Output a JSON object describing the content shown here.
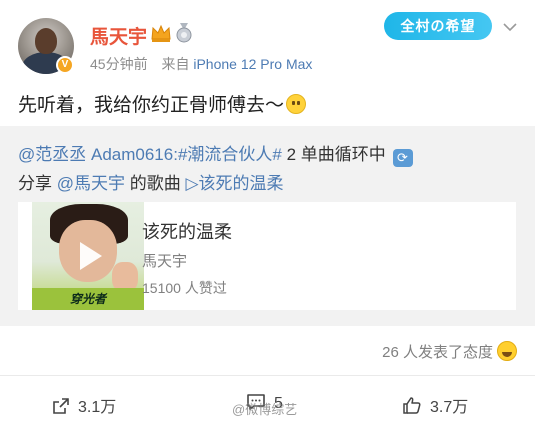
{
  "post": {
    "author": "馬天宇",
    "title_badge": "全村の希望",
    "time": "45分钟前",
    "source_prefix": "来自",
    "device": "iPhone 12 Pro Max",
    "text": "先听着，我给你约正骨师傅去～"
  },
  "repost": {
    "mention": "@范丞丞 Adam0616:",
    "hashtag": "#潮流合伙人#",
    "line1_rest": " 2 单曲循环中",
    "share_prefix": "分享",
    "share_mention": "@馬天宇",
    "share_mid": " 的歌曲 ",
    "song_link": "▷该死的温柔",
    "card": {
      "title": "该死的温柔",
      "artist": "馬天宇",
      "likes": "15100 人赞过",
      "album_text": "穿光者"
    }
  },
  "reactions": {
    "text": "26 人发表了态度"
  },
  "actions": {
    "forward": "3.1万",
    "comments": "5",
    "likes": "3.7万"
  },
  "watermark": "@微博综艺",
  "colors": {
    "username": "#e8553b",
    "link": "#4d7bb3",
    "repost_bg": "#f2f2f2"
  }
}
